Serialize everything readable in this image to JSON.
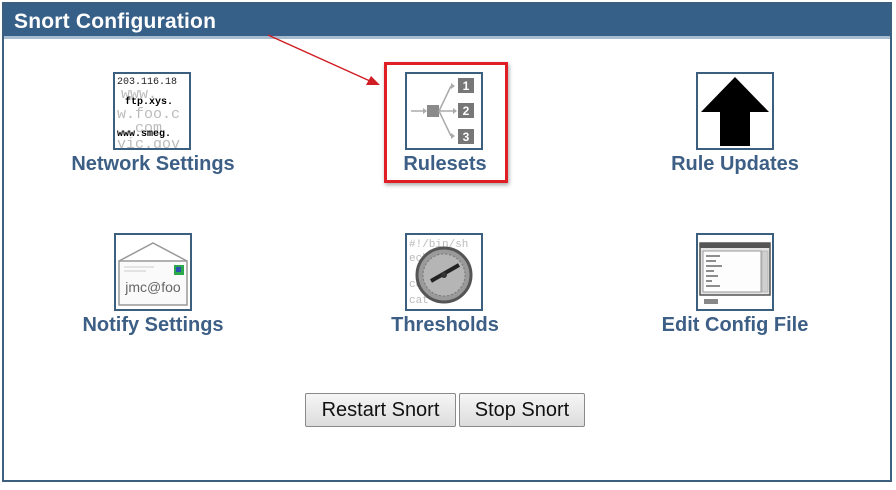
{
  "window": {
    "title": "Snort Configuration"
  },
  "colors": {
    "title_bar": "#376089",
    "label_text": "#3d5f86",
    "highlight_border": "#e01e26",
    "annotation_arrow": "#d01d24"
  },
  "items": [
    {
      "label": "Network Settings",
      "icon": "network-settings-icon",
      "icon_text": [
        "203.116.18",
        "www.",
        "ftp.xys.",
        "w.foo.c",
        "com",
        "www.smeg.",
        "vic.gov"
      ]
    },
    {
      "label": "Rulesets",
      "icon": "rulesets-icon",
      "icon_numbers": [
        "1",
        "2",
        "3"
      ]
    },
    {
      "label": "Rule Updates",
      "icon": "up-arrow-icon"
    },
    {
      "label": "Notify Settings",
      "icon": "envelope-icon",
      "icon_text": "jmc@foo"
    },
    {
      "label": "Thresholds",
      "icon": "gauge-icon",
      "icon_text": [
        "#!/bin/sh",
        "echo",
        "cd",
        "cat /b"
      ]
    },
    {
      "label": "Edit Config File",
      "icon": "config-file-icon"
    }
  ],
  "buttons": {
    "restart": "Restart Snort",
    "stop": "Stop Snort"
  }
}
